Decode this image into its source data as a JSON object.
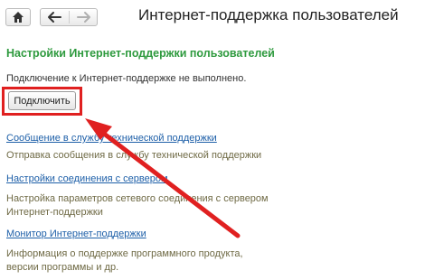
{
  "window": {
    "title": "Интернет-поддержка пользователей"
  },
  "toolbar": {
    "home_icon": "home-icon",
    "back_icon": "arrow-left-icon",
    "forward_icon": "arrow-right-icon"
  },
  "main": {
    "section_title": "Настройки Интернет-поддержки пользователей",
    "status": "Подключение к Интернет-поддержке не выполнено.",
    "connect_button": "Подключить",
    "links": [
      {
        "label": "Сообщение в службу технической поддержки",
        "description": "Отправка сообщения в службу технической поддержки"
      },
      {
        "label": "Настройки соединения с сервером",
        "description_lines": [
          "Настройка параметров сетевого соединения с сервером",
          "Интернет-поддержки"
        ]
      },
      {
        "label": "Монитор Интернет-поддержки",
        "description_lines": [
          "Информация о поддержке программного продукта,",
          "версии программы и др."
        ]
      }
    ]
  },
  "annotation": {
    "highlight_color": "#e02020",
    "arrow_color": "#e02020"
  },
  "colors": {
    "section_title": "#2e9a3e",
    "link": "#1d5fa8",
    "description": "#6f6a45"
  }
}
